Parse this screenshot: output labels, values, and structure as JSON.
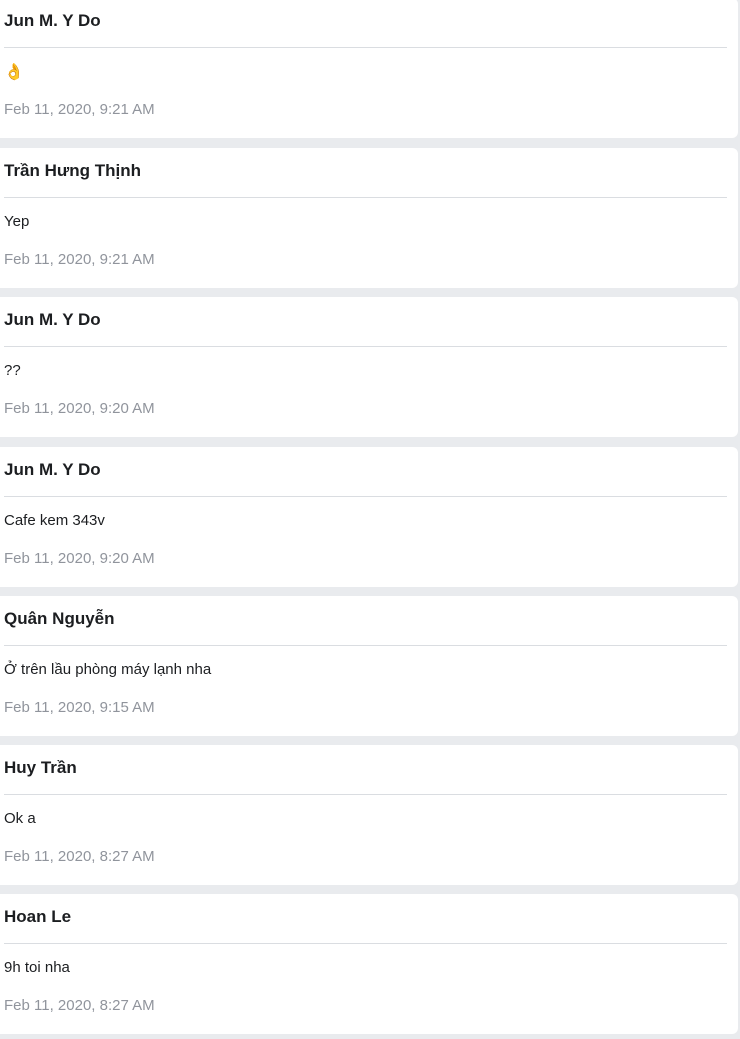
{
  "messages": [
    {
      "sender": "Jun M. Y Do",
      "text": "👌",
      "timestamp": "Feb 11, 2020, 9:21 AM"
    },
    {
      "sender": "Trần Hưng Thịnh",
      "text": "Yep",
      "timestamp": "Feb 11, 2020, 9:21 AM"
    },
    {
      "sender": "Jun M. Y Do",
      "text": "??",
      "timestamp": "Feb 11, 2020, 9:20 AM"
    },
    {
      "sender": "Jun M. Y Do",
      "text": "Cafe kem 343v",
      "timestamp": "Feb 11, 2020, 9:20 AM"
    },
    {
      "sender": "Quân Nguyễn",
      "text": "Ở trên lầu phòng máy lạnh nha",
      "timestamp": "Feb 11, 2020, 9:15 AM"
    },
    {
      "sender": "Huy Trần",
      "text": "Ok a",
      "timestamp": "Feb 11, 2020, 8:27 AM"
    },
    {
      "sender": "Hoan Le",
      "text": "9h toi nha",
      "timestamp": "Feb 11, 2020, 8:27 AM"
    }
  ],
  "colors": {
    "page_background": "#e9ebee",
    "card_background": "#ffffff",
    "sender_text": "#1c1e21",
    "timestamp_text": "#90949c",
    "divider": "#dadde1"
  }
}
